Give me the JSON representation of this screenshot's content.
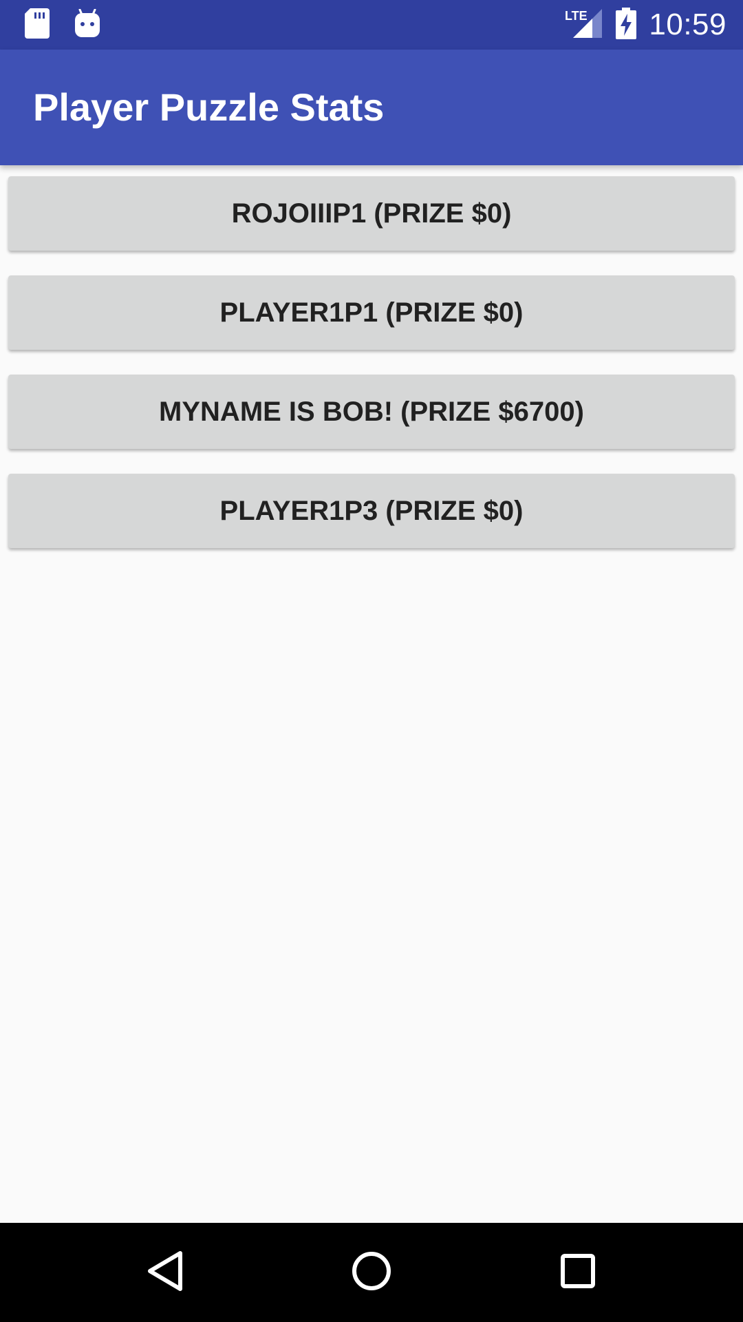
{
  "status_bar": {
    "time": "10:59",
    "left_icons": [
      "sd-card-icon",
      "android-debug-icon"
    ],
    "network_label": "LTE",
    "right_icons": [
      "lte-signal-icon",
      "battery-charging-icon"
    ],
    "background": "#303f9f"
  },
  "app_bar": {
    "title": "Player Puzzle Stats",
    "background": "#3f51b5"
  },
  "players": [
    {
      "label": "ROJOIIIP1 (PRIZE $0)"
    },
    {
      "label": "PLAYER1P1 (PRIZE $0)"
    },
    {
      "label": "MYNAME IS BOB! (PRIZE $6700)"
    },
    {
      "label": "PLAYER1P3 (PRIZE $0)"
    }
  ],
  "nav_bar": {
    "buttons": [
      "back-icon",
      "home-icon",
      "recents-icon"
    ],
    "background": "#000000"
  }
}
